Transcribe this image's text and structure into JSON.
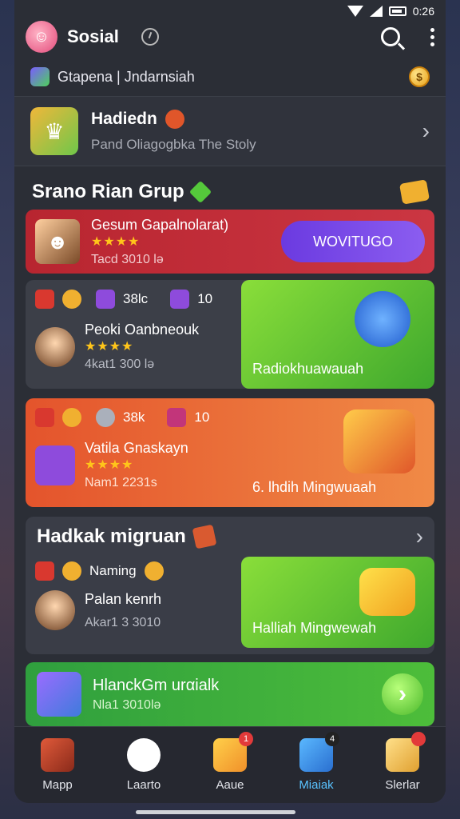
{
  "status": {
    "time": "0:26"
  },
  "header": {
    "title": "Sosial"
  },
  "subbar": {
    "text": "Gtapena | Jndarnsiah"
  },
  "banner": {
    "title": "Hadiedn",
    "subtitle": "Pand Oliagogbka The Stoly"
  },
  "section1": {
    "title": "Srano Rian Grup"
  },
  "card_red": {
    "name": "Gesum Gapalnolarat)",
    "stars": "★★★★",
    "meta": "Tacd 3010 lə",
    "button": "WOVITUGO"
  },
  "card_green": {
    "stat1": "38lc",
    "stat2": "10",
    "name": "Peoki Oanbneouk",
    "stars": "★★★★",
    "meta": "4kat1 300 lə",
    "panel_label": "Radiokhuawauah"
  },
  "card_orange": {
    "stat1": "38k",
    "stat2": "10",
    "name": "Vatila Gnaskayn",
    "stars": "★★★★",
    "meta": "Nam1 2231s",
    "panel_label": "6. lhdih Mingwuaah"
  },
  "section2": {
    "title": "Hadkak migruan",
    "row1": "Naming",
    "row2": "Palan kenrh",
    "meta": "Akar1 3 3010",
    "panel_label": "Halliah Mingwewah"
  },
  "green_bottom": {
    "title": "HlanckGm urαialk",
    "meta": "Nla1 3010lə"
  },
  "nav": [
    {
      "label": "Mapp"
    },
    {
      "label": "Laarto"
    },
    {
      "label": "Aaue",
      "badge": "1"
    },
    {
      "label": "Miaiak",
      "badge": "4"
    },
    {
      "label": "Slerlar"
    }
  ]
}
